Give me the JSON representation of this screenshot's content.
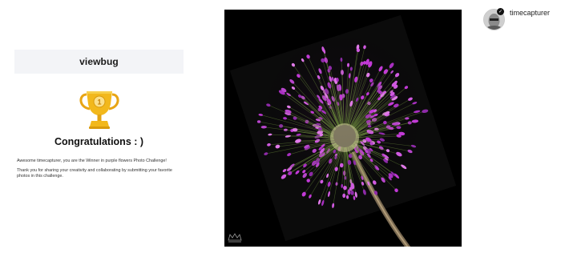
{
  "email": {
    "brand": "viewbug",
    "trophy_icon": "trophy-icon",
    "headline": "Congratulations : )",
    "message_1": "Awesome timecapturer, you are the Winner in purple flowers Photo Challenge!",
    "message_2": "Thank you for sharing your creativity and collaborating by submitting your favorite photos in this challenge."
  },
  "photo": {
    "subject": "purple allium flower",
    "background_color": "#000000",
    "flower_color": "#b040c8"
  },
  "user": {
    "username": "timecapturer",
    "verified_icon": "check-badge-icon"
  },
  "colors": {
    "trophy_gold": "#f2b81c",
    "brand_bar_bg": "#f3f4f7"
  }
}
